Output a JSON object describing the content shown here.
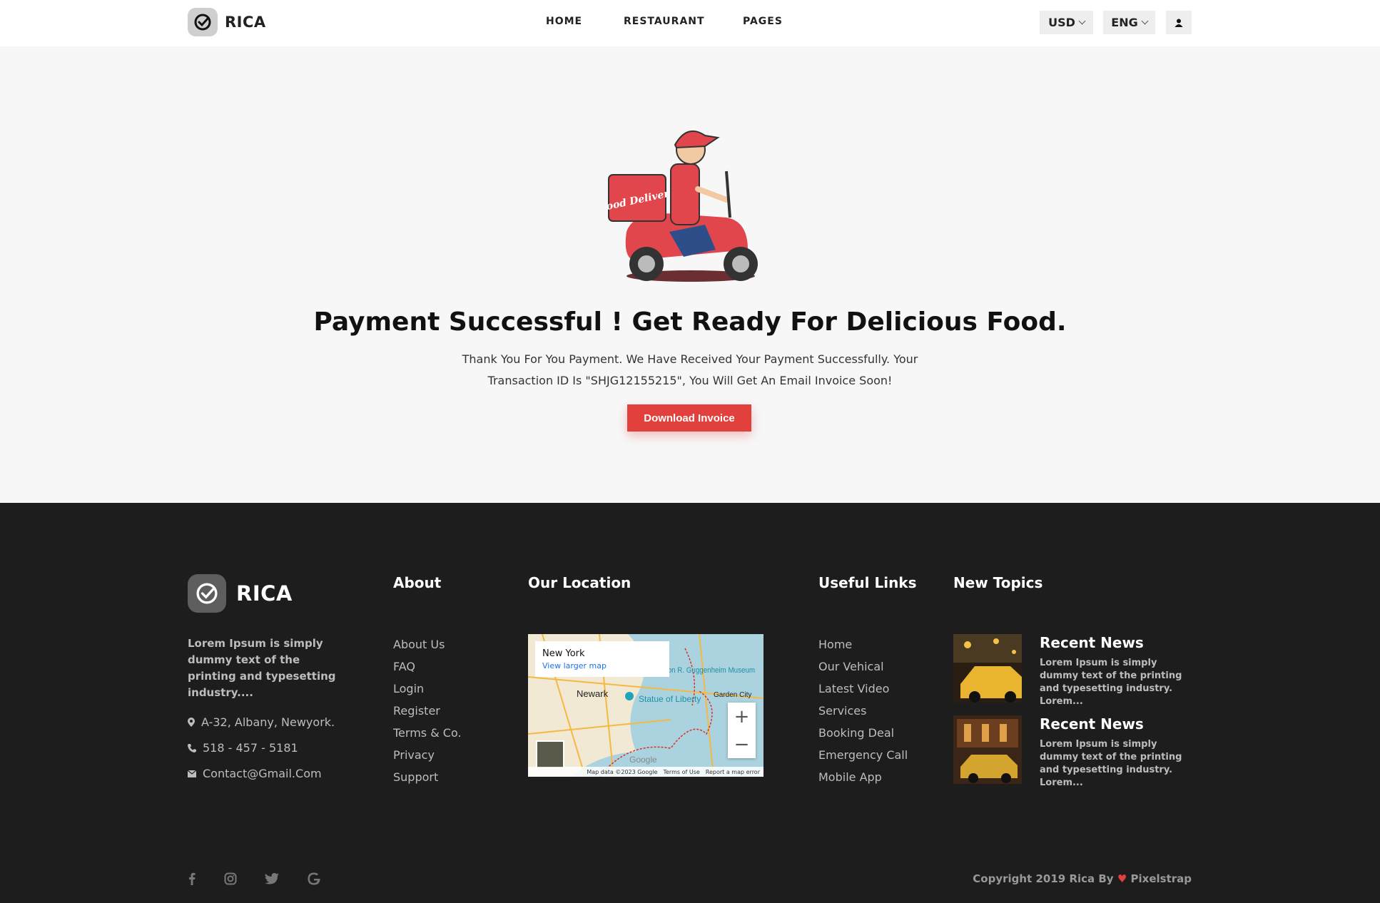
{
  "header": {
    "brand": "RICA",
    "nav": [
      "HOME",
      "RESTAURANT",
      "PAGES"
    ],
    "currency": "USD",
    "language": "ENG"
  },
  "main": {
    "illustration_label": "Food Delivery",
    "title": "Payment Successful ! Get Ready For Delicious Food.",
    "description": "Thank You For You Payment. We Have Received Your Payment Successfully. Your Transaction ID Is \"SHJG12155215\", You Will Get An Email Invoice Soon!",
    "button": "Download Invoice"
  },
  "footer": {
    "brand": "RICA",
    "about_text": "Lorem Ipsum is simply dummy text of the printing and typesetting industry....",
    "contact": {
      "address": "A-32, Albany, Newyork.",
      "phone": "518 - 457 - 5181",
      "email": "Contact@Gmail.Com"
    },
    "about": {
      "heading": "About",
      "links": [
        "About Us",
        "FAQ",
        "Login",
        "Register",
        "Terms & Co.",
        "Privacy",
        "Support"
      ]
    },
    "location": {
      "heading": "Our Location",
      "map_title": "New York",
      "map_link": "View larger map",
      "map_labels": [
        "Newark",
        "Statue of Liberty",
        "Garden City",
        "Solomon R. Guggenheim Museum",
        "Google"
      ],
      "map_footer": [
        "Map data ©2023 Google",
        "Terms of Use",
        "Report a map error"
      ]
    },
    "useful": {
      "heading": "Useful Links",
      "links": [
        "Home",
        "Our Vehical",
        "Latest Video",
        "Services",
        "Booking Deal",
        "Emergency Call",
        "Mobile App"
      ]
    },
    "topics": {
      "heading": "New Topics",
      "items": [
        {
          "title": "Recent News",
          "text": "Lorem Ipsum is simply dummy text of the printing and typesetting industry. Lorem..."
        },
        {
          "title": "Recent News",
          "text": "Lorem Ipsum is simply dummy text of the printing and typesetting industry. Lorem..."
        }
      ]
    },
    "social": [
      "facebook-icon",
      "instagram-icon",
      "twitter-icon",
      "google-icon"
    ],
    "copyright_prefix": "Copyright 2019 Rica By",
    "copyright_suffix": "Pixelstrap"
  },
  "colors": {
    "accent": "#e2403d",
    "footer_bg": "#1d1d1d",
    "page_bg": "#f7f7f7"
  }
}
